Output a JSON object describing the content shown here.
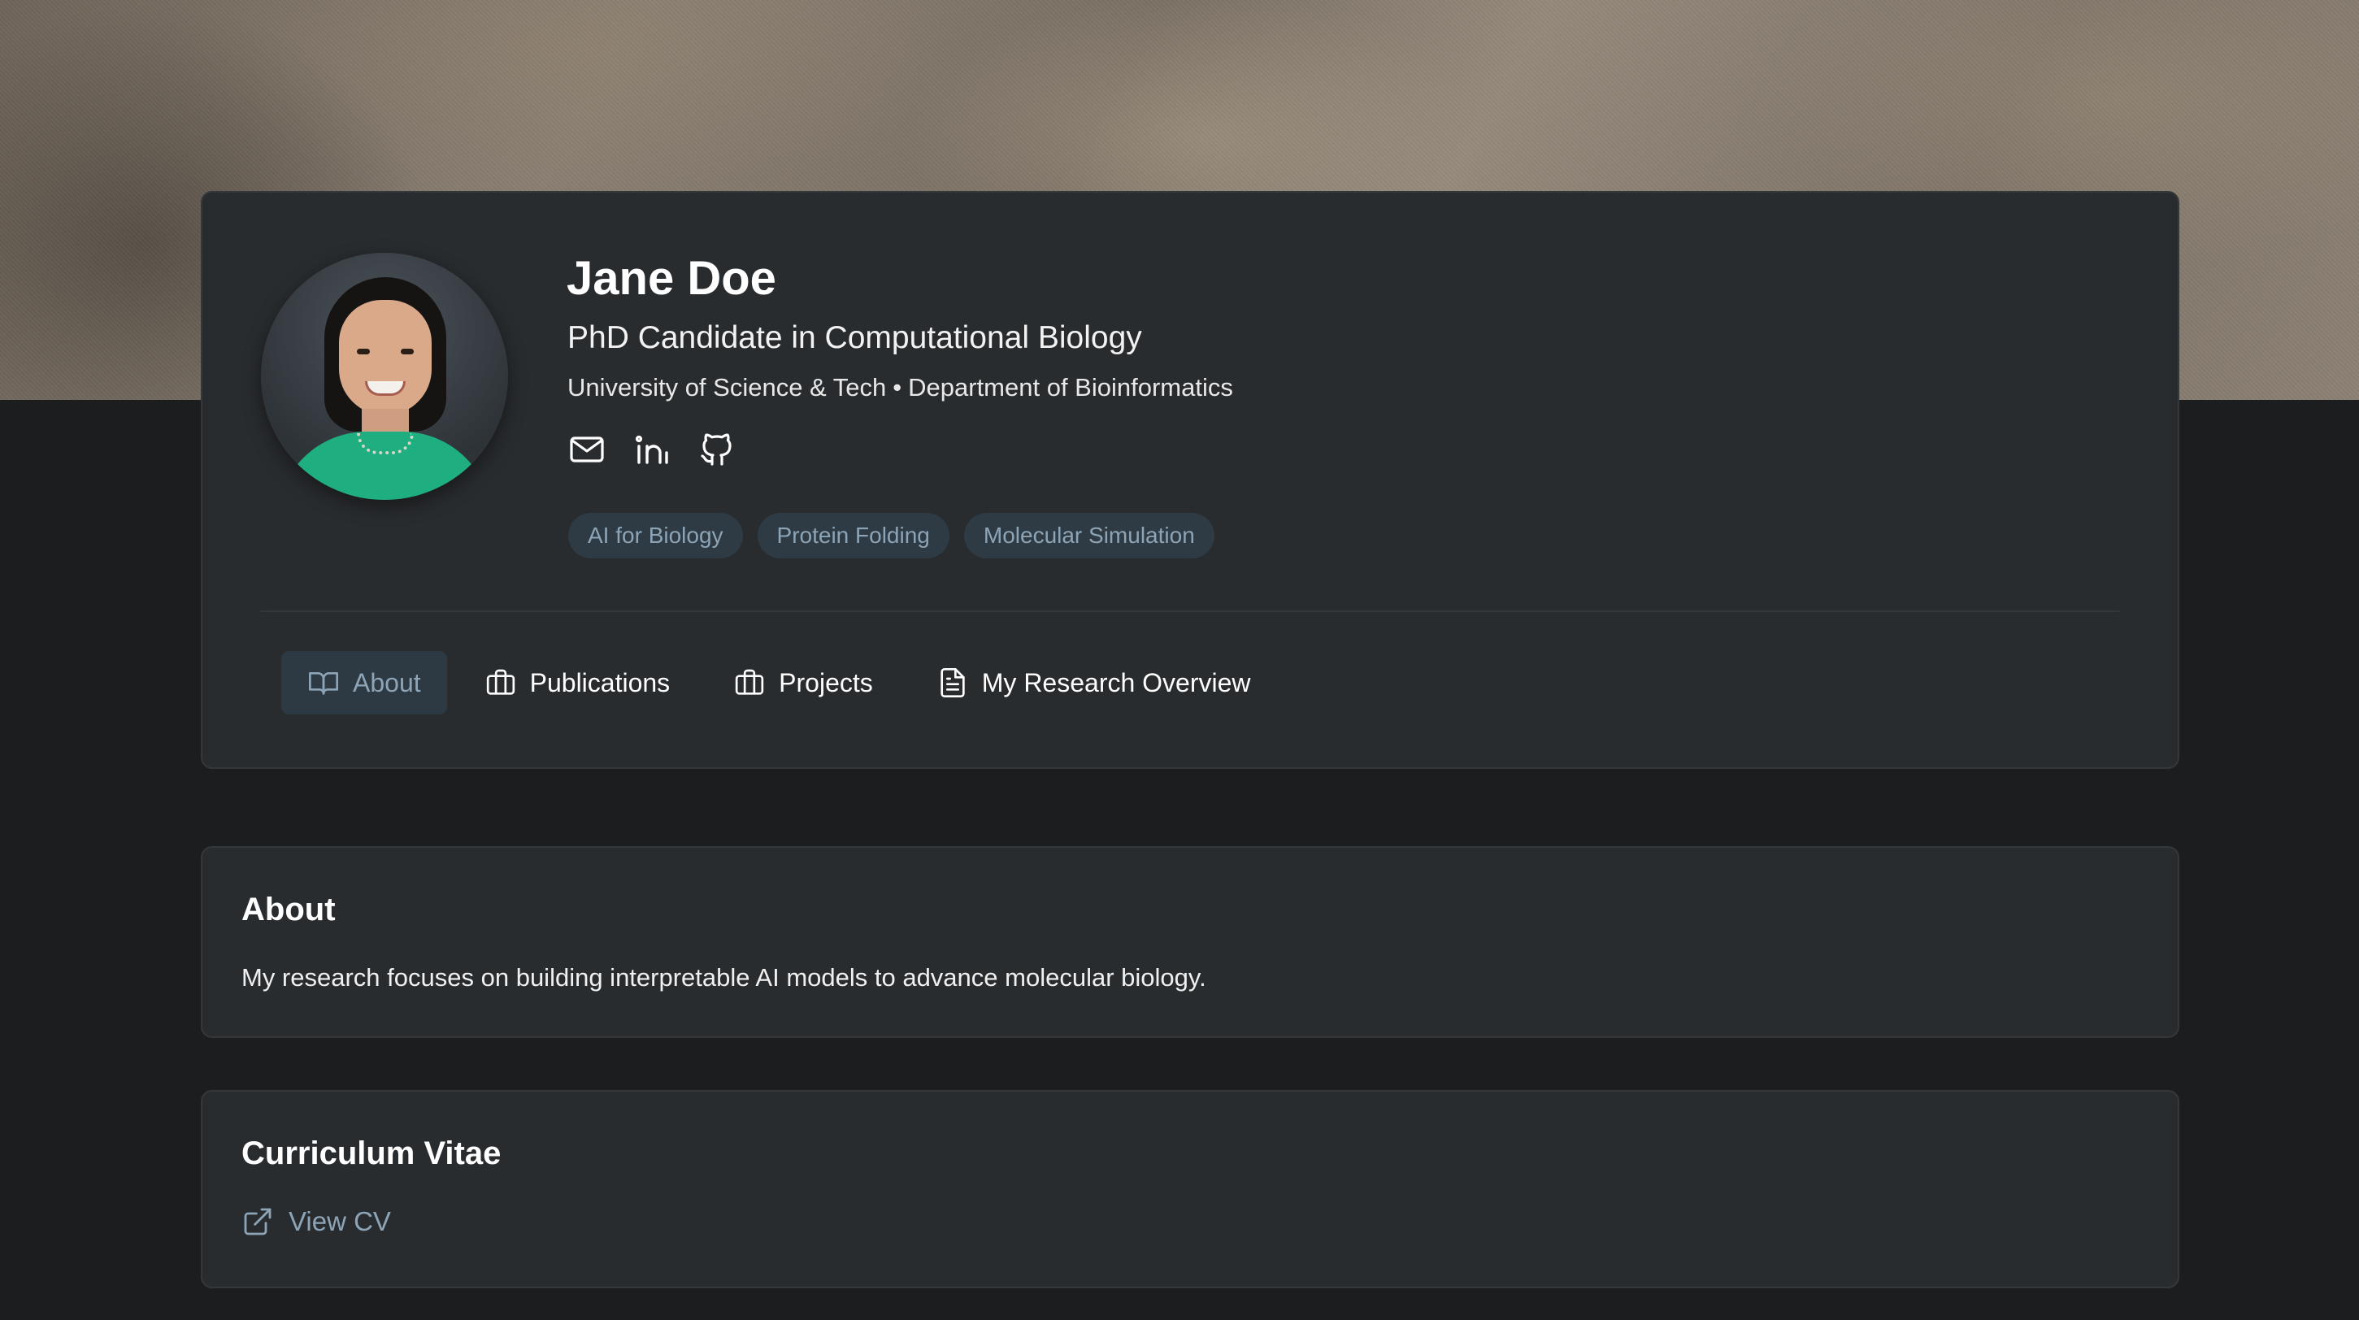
{
  "profile": {
    "name": "Jane Doe",
    "title": "PhD Candidate in Computational Biology",
    "university": "University of Science & Tech",
    "separator": "•",
    "department": "Department of Bioinformatics",
    "socials": [
      {
        "icon": "mail-icon"
      },
      {
        "icon": "linkedin-icon"
      },
      {
        "icon": "github-icon"
      }
    ],
    "tags": [
      "AI for Biology",
      "Protein Folding",
      "Molecular Simulation"
    ]
  },
  "tabs": [
    {
      "label": "About",
      "icon": "book-open-icon",
      "active": true
    },
    {
      "label": "Publications",
      "icon": "briefcase-icon",
      "active": false
    },
    {
      "label": "Projects",
      "icon": "briefcase-icon",
      "active": false
    },
    {
      "label": "My Research Overview",
      "icon": "document-icon",
      "active": false
    }
  ],
  "about": {
    "title": "About",
    "text": "My research focuses on building interpretable AI models to advance molecular biology."
  },
  "cv": {
    "title": "Curriculum Vitae",
    "link_label": "View CV",
    "link_icon": "external-link-icon"
  },
  "colors": {
    "background": "#1b1d1f",
    "card": "#292c2f",
    "accent": "#8ca4b6",
    "tag_bg": "#2f3b44"
  }
}
